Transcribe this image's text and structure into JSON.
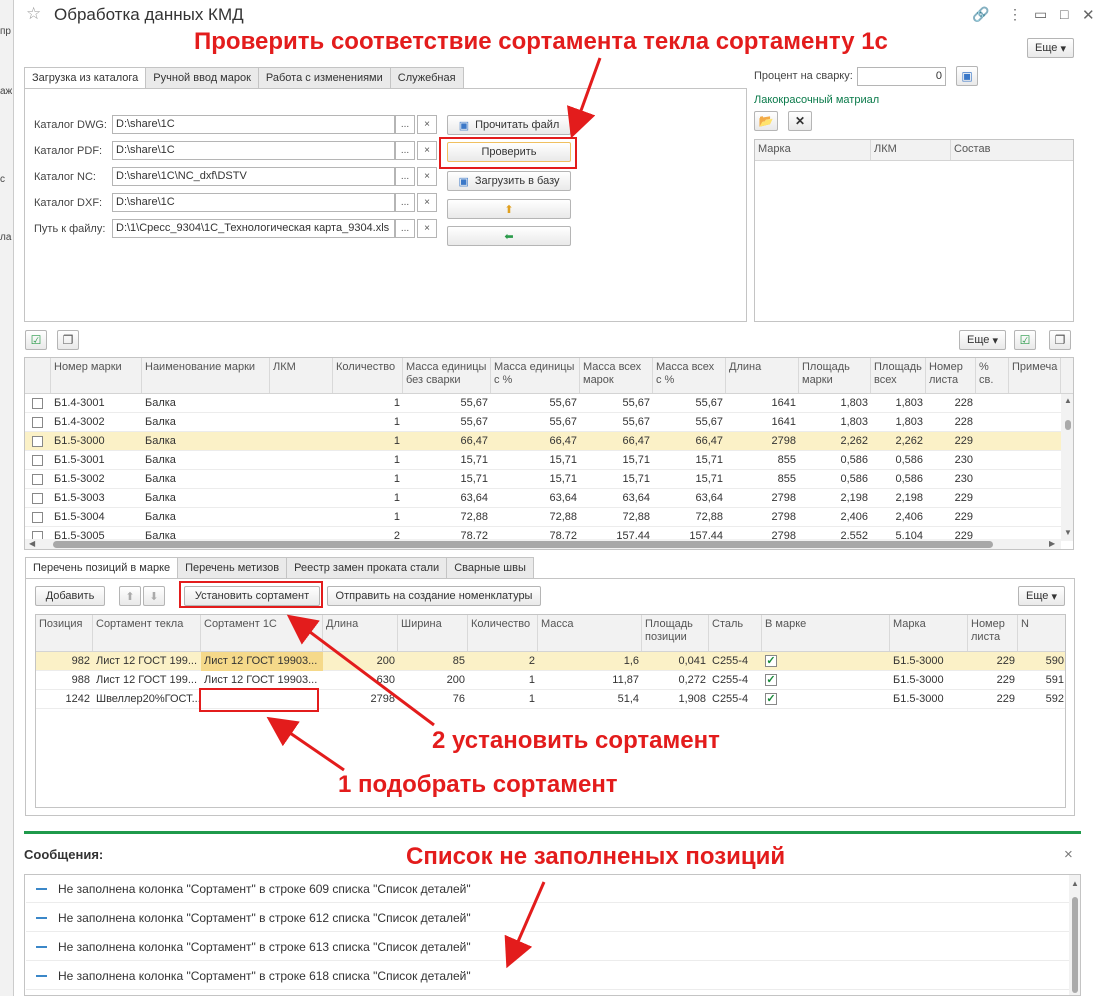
{
  "window": {
    "title": "Обработка данных КМД",
    "more_label": "Еще"
  },
  "left_strip": [
    "пр",
    "аж",
    "с",
    "ла"
  ],
  "tabs_top": [
    "Загрузка из каталога",
    "Ручной ввод марок",
    "Работа с изменениями",
    "Служебная"
  ],
  "catalog": {
    "rows": [
      {
        "label": "Каталог DWG:",
        "value": "D:\\share\\1C"
      },
      {
        "label": "Каталог PDF:",
        "value": "D:\\share\\1C"
      },
      {
        "label": "Каталог NC:",
        "value": "D:\\share\\1C\\NC_dxf\\DSTV"
      },
      {
        "label": "Каталог DXF:",
        "value": "D:\\share\\1C"
      },
      {
        "label": "Путь к файлу:",
        "value": "D:\\1\\Cресс_9304\\1C_Технологическая карта_9304.xls"
      }
    ],
    "ellipsis": "...",
    "clear": "×",
    "read_file": "Прочитать файл",
    "check": "Проверить",
    "load_db": "Загрузить в базу"
  },
  "right_panel": {
    "weld_label": "Процент на сварку:",
    "weld_value": "0",
    "paint_label": "Лакокрасочный матриал",
    "columns": [
      "Марка",
      "ЛКМ",
      "Состав"
    ]
  },
  "marks_table": {
    "more_label": "Еще",
    "columns": [
      "Номер марки",
      "Наименование марки",
      "ЛКМ",
      "Количество",
      "Масса единицы без сварки",
      "Масса единицы с %",
      "Масса всех марок",
      "Масса всех с %",
      "Длина",
      "Площадь марки",
      "Площадь всех",
      "Номер листа",
      "% св.",
      "Примеча"
    ],
    "rows": [
      [
        "Б1.4-3001",
        "Балка",
        "",
        "1",
        "55,67",
        "55,67",
        "55,67",
        "55,67",
        "1641",
        "1,803",
        "1,803",
        "228"
      ],
      [
        "Б1.4-3002",
        "Балка",
        "",
        "1",
        "55,67",
        "55,67",
        "55,67",
        "55,67",
        "1641",
        "1,803",
        "1,803",
        "228"
      ],
      [
        "Б1.5-3000",
        "Балка",
        "",
        "1",
        "66,47",
        "66,47",
        "66,47",
        "66,47",
        "2798",
        "2,262",
        "2,262",
        "229"
      ],
      [
        "Б1.5-3001",
        "Балка",
        "",
        "1",
        "15,71",
        "15,71",
        "15,71",
        "15,71",
        "855",
        "0,586",
        "0,586",
        "230"
      ],
      [
        "Б1.5-3002",
        "Балка",
        "",
        "1",
        "15,71",
        "15,71",
        "15,71",
        "15,71",
        "855",
        "0,586",
        "0,586",
        "230"
      ],
      [
        "Б1.5-3003",
        "Балка",
        "",
        "1",
        "63,64",
        "63,64",
        "63,64",
        "63,64",
        "2798",
        "2,198",
        "2,198",
        "229"
      ],
      [
        "Б1.5-3004",
        "Балка",
        "",
        "1",
        "72,88",
        "72,88",
        "72,88",
        "72,88",
        "2798",
        "2,406",
        "2,406",
        "229"
      ],
      [
        "Б1.5-3005",
        "Балка",
        "",
        "2",
        "78,72",
        "78,72",
        "157,44",
        "157,44",
        "2798",
        "2,552",
        "5,104",
        "229"
      ]
    ]
  },
  "tabs_bottom": [
    "Перечень позиций в марке",
    "Перечень метизов",
    "Реестр замен проката стали",
    "Сварные швы"
  ],
  "positions": {
    "add": "Добавить",
    "set": "Установить сортамент",
    "send": "Отправить на создание номенклатуры",
    "more_label": "Еще",
    "columns": [
      "Позиция",
      "Сортамент текла",
      "Сортамент 1С",
      "Длина",
      "Ширина",
      "Количество",
      "Масса",
      "Площадь позиции",
      "Сталь",
      "В марке",
      "Марка",
      "Номер листа",
      "N"
    ],
    "rows": [
      [
        "982",
        "Лист 12 ГОСТ 199...",
        "Лист 12 ГОСТ 19903...",
        "200",
        "85",
        "2",
        "1,6",
        "0,041",
        "С255-4",
        "",
        "Б1.5-3000",
        "229",
        "590"
      ],
      [
        "988",
        "Лист 12 ГОСТ 199...",
        "Лист 12 ГОСТ 19903...",
        "630",
        "200",
        "1",
        "11,87",
        "0,272",
        "С255-4",
        "",
        "Б1.5-3000",
        "229",
        "591"
      ],
      [
        "1242",
        "Швеллер20%ГОСТ...",
        "",
        "2798",
        "76",
        "1",
        "51,4",
        "1,908",
        "С255-4",
        "",
        "Б1.5-3000",
        "229",
        "592"
      ]
    ]
  },
  "messages": {
    "title": "Сообщения:",
    "close": "×",
    "items": [
      "Не заполнена колонка \"Сортамент\" в строке 609 списка \"Список деталей\"",
      "Не заполнена колонка \"Сортамент\" в строке 612 списка \"Список деталей\"",
      "Не заполнена колонка \"Сортамент\" в строке 613 списка \"Список деталей\"",
      "Не заполнена колонка \"Сортамент\" в строке 618 списка \"Список деталей\""
    ]
  },
  "annotations": {
    "a_check": "Проверить соответствие сортамента текла сортаменту 1с",
    "a_set": "2 установить сортамент",
    "a_pick": "1 подобрать сортамент",
    "a_list": "Список не заполненых позиций"
  },
  "colors": {
    "annotation": "#e31c1c",
    "selected_row": "#fbf1c7",
    "green_bar": "#1f9a4b",
    "check_mark": "#1a8a3a"
  }
}
